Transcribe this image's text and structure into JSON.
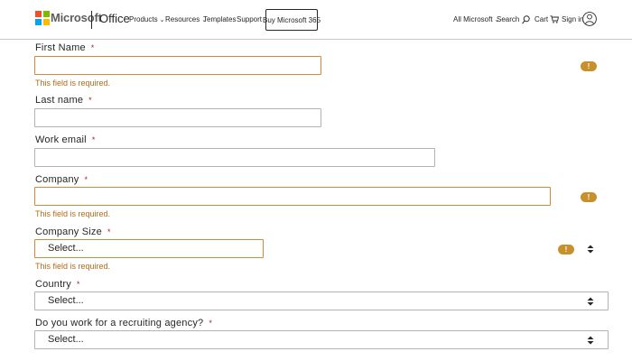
{
  "header": {
    "brand": "Microsoft",
    "product": "Office",
    "nav": [
      {
        "label": "Products",
        "chevron": "⌄"
      },
      {
        "label": "Resources",
        "chevron": "⌄"
      },
      {
        "label": "Templates"
      },
      {
        "label": "Support"
      }
    ],
    "buy_button": "Buy Microsoft 365",
    "all_microsoft": "All Microsoft",
    "all_chevron": "⌄",
    "search": "Search",
    "cart": "Cart",
    "sign_in": "Sign in"
  },
  "form": {
    "required_mark": "*",
    "error_message": "This field is required.",
    "first_name": {
      "label": "First Name"
    },
    "last_name": {
      "label": "Last name"
    },
    "work_email": {
      "label": "Work email"
    },
    "company": {
      "label": "Company"
    },
    "company_size": {
      "label": "Company Size",
      "value": "Select..."
    },
    "country": {
      "label": "Country",
      "value": "Select..."
    },
    "recruiting": {
      "label": "Do you work for a recruiting agency?",
      "value": "Select..."
    },
    "warning_glyph": "!"
  },
  "colors": {
    "error_border": "#d08a3c",
    "error_text": "#b06b17",
    "warning_badge": "#c8902a",
    "header_border": "#c8c8c8"
  }
}
